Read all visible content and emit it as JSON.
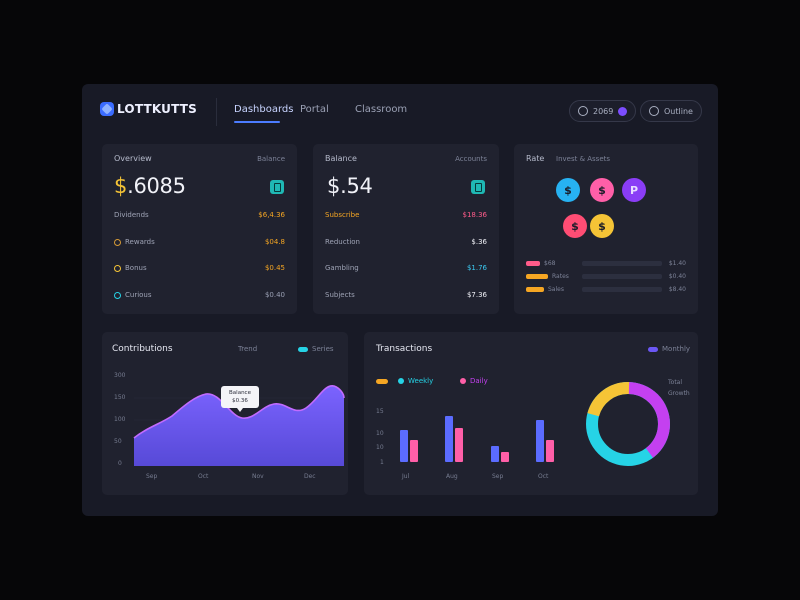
{
  "header": {
    "brand": "LOTTKUTTS",
    "tabs": [
      {
        "label": "Dashboards",
        "active": true
      },
      {
        "label": "Portal",
        "active": false
      },
      {
        "label": "Classroom",
        "active": false
      }
    ],
    "pill_left": "2069",
    "pill_right": "Outline"
  },
  "card1": {
    "title": "Overview",
    "meta": "Balance",
    "value_symbol": "$",
    "value_number": ".6085",
    "rows": [
      {
        "label": "Dividends",
        "value": "$6,4.36",
        "color": "#f5a623"
      },
      {
        "label": "Rewards",
        "value": "$04.8",
        "color": "#f5a623"
      },
      {
        "label": "Bonus",
        "value": "$0.45",
        "color": "#f5a623"
      },
      {
        "label": "Curious",
        "value": "$0.40",
        "color": "#9aa0b4"
      }
    ]
  },
  "card2": {
    "title": "Balance",
    "meta": "Accounts",
    "value_symbol": "$",
    "value_number": ".54",
    "rows": [
      {
        "label": "Subscribe",
        "value": "$18.36",
        "color": "#ff5c8a"
      },
      {
        "label": "Reduction",
        "value": "$.36",
        "color": "#f1f2f8"
      },
      {
        "label": "Gambling",
        "value": "$1.76",
        "color": "#3bc8f0"
      },
      {
        "label": "Subjects",
        "value": "$7.36",
        "color": "#f1f2f8"
      }
    ]
  },
  "card3": {
    "title": "Rate",
    "meta": "Invest & Assets",
    "coins": [
      {
        "glyph": "$",
        "color": "#27b2f2"
      },
      {
        "glyph": "$",
        "color": "#ff5fa8"
      },
      {
        "glyph": "P",
        "color": "#8a3df6"
      },
      {
        "glyph": "$",
        "color": "#ff4d74"
      },
      {
        "glyph": "$",
        "color": "#f5c436"
      }
    ],
    "legend": [
      {
        "color": "#ff5c8a",
        "label": "$68",
        "right": "$1.40"
      },
      {
        "color": "#f5a623",
        "label": "Rates",
        "right": "$0.40"
      },
      {
        "color": "#f5a623",
        "label": "Sales",
        "right": "$8.40"
      }
    ]
  },
  "area_chart": {
    "title": "Contributions",
    "legend_a": "Trend",
    "legend_b": "Series",
    "tooltip_line1": "Balance",
    "tooltip_line2": "$0.36",
    "y_labels": [
      "300",
      "150",
      "100",
      "50",
      "0"
    ],
    "x_labels": [
      "Sep",
      "Oct",
      "Nov",
      "Dec"
    ],
    "colors": {
      "fill": "#6b57f5",
      "line": "#9b6bff"
    }
  },
  "bar_chart": {
    "title": "Transactions",
    "legend_right": "Monthly",
    "chip_label": "",
    "series_labels": [
      "Weekly",
      "Daily"
    ],
    "y_labels": [
      "15",
      "10",
      "10",
      "1"
    ],
    "x_labels": [
      "Jul",
      "Aug",
      "Sep",
      "Oct"
    ],
    "colors": {
      "blue": "#5b6cff",
      "pink": "#ff5fa8"
    }
  },
  "donut": {
    "label_a": "Total",
    "label_b": "Growth",
    "colors": {
      "yellow": "#f5c436",
      "purple": "#c440f0",
      "cyan": "#26d3e6"
    }
  }
}
